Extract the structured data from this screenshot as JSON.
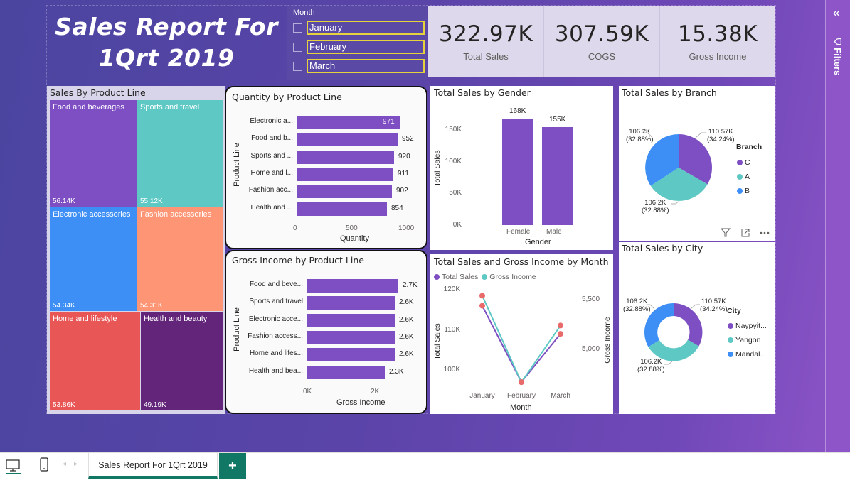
{
  "title": {
    "line1": "Sales Report For",
    "line2": "1Qrt 2019"
  },
  "slicer": {
    "header": "Month",
    "items": [
      "January",
      "February",
      "March"
    ]
  },
  "kpis": [
    {
      "value": "322.97K",
      "label": "Total Sales"
    },
    {
      "value": "307.59K",
      "label": "COGS"
    },
    {
      "value": "15.38K",
      "label": "Gross Income"
    }
  ],
  "treemap": {
    "title": "Sales By Product Line",
    "cells": [
      {
        "name": "Food and beverages",
        "value": "56.14K",
        "color": "#7e4fc2"
      },
      {
        "name": "Sports and travel",
        "value": "55.12K",
        "color": "#5ec8c4"
      },
      {
        "name": "Electronic accessories",
        "value": "54.34K",
        "color": "#3d8ff5"
      },
      {
        "name": "Fashion accessories",
        "value": "54.31K",
        "color": "#fe9574"
      },
      {
        "name": "Home and lifestyle",
        "value": "53.86K",
        "color": "#e85656"
      },
      {
        "name": "Health and beauty",
        "value": "49.19K",
        "color": "#63257a"
      }
    ]
  },
  "qty_chart": {
    "title": "Quantity by Product Line",
    "ylabel": "Product Line",
    "xlabel": "Quantity",
    "categories": [
      "Electronic a...",
      "Food and b...",
      "Sports and ...",
      "Home and l...",
      "Fashion acc...",
      "Health and ..."
    ],
    "values": [
      971,
      952,
      920,
      911,
      902,
      854
    ],
    "value_labels": [
      "971",
      "952",
      "920",
      "911",
      "902",
      "854"
    ],
    "ticks": [
      "0",
      "500",
      "1000"
    ],
    "xlim": [
      0,
      1000
    ]
  },
  "gi_chart": {
    "title": "Gross Income by Product Line",
    "ylabel": "Product Line",
    "xlabel": "Gross Income",
    "categories": [
      "Food and beve...",
      "Sports and travel",
      "Electronic acce...",
      "Fashion access...",
      "Home and lifes...",
      "Health and bea..."
    ],
    "values": [
      2.7,
      2.6,
      2.6,
      2.6,
      2.6,
      2.3
    ],
    "value_labels": [
      "2.7K",
      "2.6K",
      "2.6K",
      "2.6K",
      "2.6K",
      "2.3K"
    ],
    "ticks": [
      "0K",
      "2K"
    ],
    "xlim": [
      0,
      2.7
    ]
  },
  "gender_chart": {
    "title": "Total Sales by Gender",
    "ylabel": "Total Sales",
    "xlabel": "Gender",
    "categories": [
      "Female",
      "Male"
    ],
    "values": [
      168,
      155
    ],
    "value_labels": [
      "168K",
      "155K"
    ],
    "ticks": [
      "150K",
      "100K",
      "50K",
      "0K"
    ],
    "ylim": [
      0,
      168
    ]
  },
  "month_chart": {
    "title": "Total Sales and Gross Income by Month",
    "legend": [
      "Total Sales",
      "Gross Income"
    ],
    "ylabel_left": "Total Sales",
    "ylabel_right": "Gross Income",
    "xlabel": "Month",
    "categories": [
      "January",
      "February",
      "March"
    ],
    "left_ticks": [
      "120K",
      "110K",
      "100K"
    ],
    "right_ticks": [
      "5,500",
      "5,000"
    ]
  },
  "branch_chart": {
    "title": "Total Sales by Branch",
    "legend_title": "Branch",
    "legend": [
      "C",
      "A",
      "B"
    ],
    "labels": [
      "110.57K (34.24%)",
      "106.2K (32.88%)",
      "106.2K (32.88%)"
    ],
    "label_lines": [
      [
        "110.57K",
        "(34.24%)"
      ],
      [
        "106.2K",
        "(32.88%)"
      ],
      [
        "106.2K",
        "(32.88%)"
      ]
    ]
  },
  "city_chart": {
    "title": "Total Sales by City",
    "legend_title": "City",
    "legend": [
      "Naypyit...",
      "Yangon",
      "Mandal..."
    ],
    "label_lines": [
      [
        "110.57K",
        "(34.24%)"
      ],
      [
        "106.2K",
        "(32.88%)"
      ],
      [
        "106.2K",
        "(32.88%)"
      ]
    ]
  },
  "colors": {
    "purple": "#7e4fc2",
    "teal": "#5ec8c4",
    "blue": "#3d8ff5",
    "marker": "#e86a6a"
  },
  "filters_pane": {
    "label": "Filters"
  },
  "bottom": {
    "page_tab": "Sales Report For 1Qrt 2019",
    "add": "+"
  },
  "chart_data": [
    {
      "type": "bar",
      "title": "Quantity by Product Line",
      "categories": [
        "Electronic accessories",
        "Food and beverages",
        "Sports and travel",
        "Home and lifestyle",
        "Fashion accessories",
        "Health and beauty"
      ],
      "values": [
        971,
        952,
        920,
        911,
        902,
        854
      ],
      "xlabel": "Quantity",
      "ylabel": "Product Line"
    },
    {
      "type": "bar",
      "title": "Gross Income by Product Line",
      "categories": [
        "Food and beverages",
        "Sports and travel",
        "Electronic accessories",
        "Fashion accessories",
        "Home and lifestyle",
        "Health and beauty"
      ],
      "values": [
        2700,
        2600,
        2600,
        2600,
        2600,
        2300
      ],
      "xlabel": "Gross Income",
      "ylabel": "Product Line"
    },
    {
      "type": "bar",
      "title": "Total Sales by Gender",
      "categories": [
        "Female",
        "Male"
      ],
      "values": [
        168000,
        155000
      ],
      "xlabel": "Gender",
      "ylabel": "Total Sales"
    },
    {
      "type": "line",
      "title": "Total Sales and Gross Income by Month",
      "categories": [
        "January",
        "February",
        "March"
      ],
      "series": [
        {
          "name": "Total Sales",
          "values": [
            116000,
            97000,
            109000
          ]
        },
        {
          "name": "Gross Income",
          "values": [
            5540,
            4670,
            5240
          ]
        }
      ]
    },
    {
      "type": "pie",
      "title": "Total Sales by Branch",
      "categories": [
        "C",
        "A",
        "B"
      ],
      "values": [
        110570,
        106200,
        106200
      ]
    },
    {
      "type": "pie",
      "title": "Total Sales by City",
      "categories": [
        "Naypyitaw",
        "Yangon",
        "Mandalay"
      ],
      "values": [
        110570,
        106200,
        106200
      ]
    }
  ]
}
